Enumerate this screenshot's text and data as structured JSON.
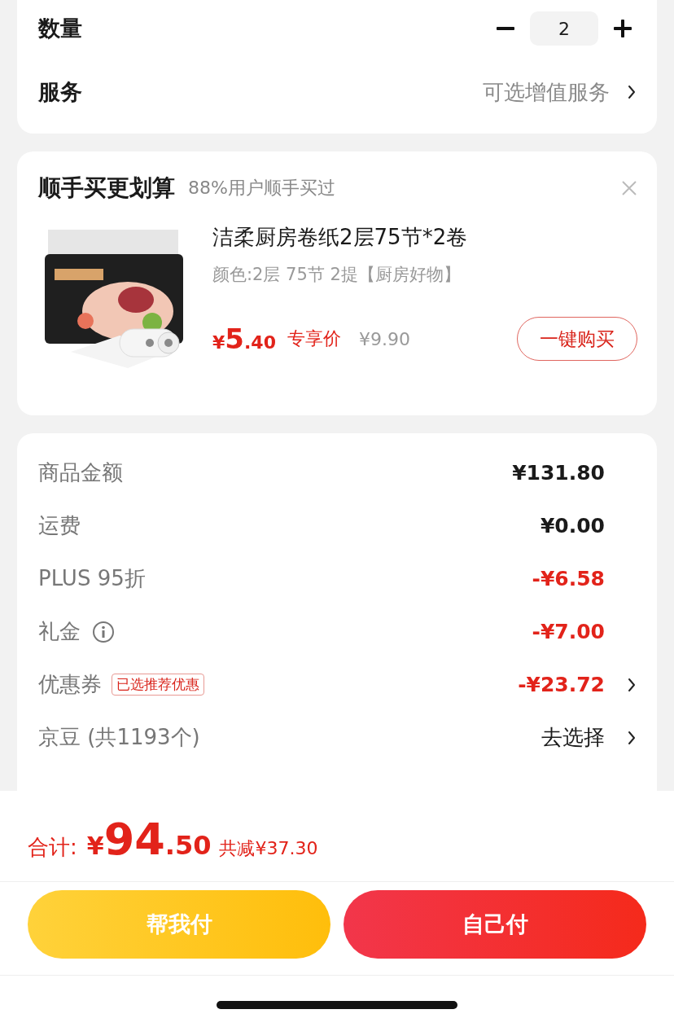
{
  "options": {
    "quantity_label": "数量",
    "quantity": "2",
    "service_label": "服务",
    "service_value": "可选增值服务"
  },
  "addon": {
    "title": "顺手买更划算",
    "subtitle": "88%用户顺手买过",
    "product": {
      "kind": "picture",
      "name": "洁柔厨房卷纸2层75节*2卷",
      "spec": "颜色:2层 75节 2提【厨房好物】",
      "currency": "¥",
      "price_int": "5",
      "price_dec": ".40",
      "price_tag": "专享价",
      "original_price": "¥9.90",
      "button": "一键购买"
    }
  },
  "summary": {
    "rows": [
      {
        "label": "商品金额",
        "value": "¥131.80",
        "discount": false,
        "chevron": false,
        "info": false
      },
      {
        "label": "运费",
        "value": "¥0.00",
        "discount": false,
        "chevron": false,
        "info": false
      },
      {
        "label": "PLUS 95折",
        "value": "-¥6.58",
        "discount": true,
        "chevron": false,
        "info": false
      },
      {
        "label": "礼金",
        "value": "-¥7.00",
        "discount": true,
        "chevron": false,
        "info": true
      },
      {
        "label": "优惠券",
        "tag": "已选推荐优惠",
        "value": "-¥23.72",
        "discount": true,
        "chevron": true,
        "info": false
      },
      {
        "label": "京豆 (共1193个)",
        "value": "去选择",
        "discount": false,
        "chevron": true,
        "info": false
      }
    ]
  },
  "footer": {
    "total_label": "合计:",
    "currency": "¥",
    "total_int": "94",
    "total_dec": ".50",
    "saved": "共减¥37.30",
    "buttons": [
      {
        "label": "帮我付",
        "kind": "secondary"
      },
      {
        "label": "自己付",
        "kind": "primary"
      }
    ]
  }
}
